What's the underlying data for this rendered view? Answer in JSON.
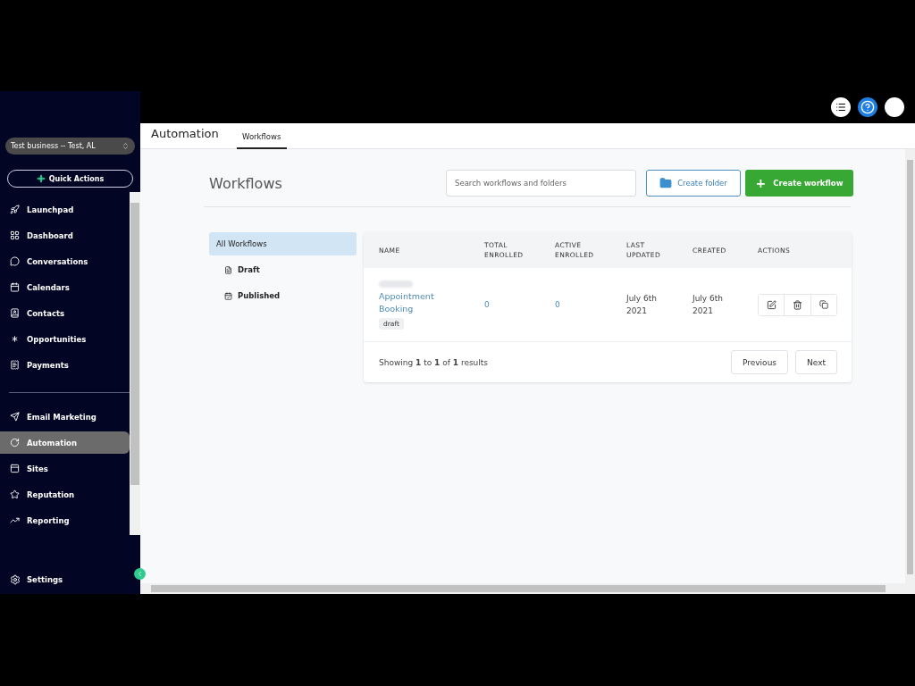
{
  "sidebar": {
    "business": "Test business -- Test, AL",
    "quick_actions": "Quick Actions",
    "items": [
      {
        "label": "Launchpad",
        "selected": false
      },
      {
        "label": "Dashboard",
        "selected": false
      },
      {
        "label": "Conversations",
        "selected": false
      },
      {
        "label": "Calendars",
        "selected": false
      },
      {
        "label": "Contacts",
        "selected": false
      },
      {
        "label": "Opportunities",
        "selected": false
      },
      {
        "label": "Payments",
        "selected": false
      }
    ],
    "items_secondary": [
      {
        "label": "Email Marketing",
        "selected": false
      },
      {
        "label": "Automation",
        "selected": true
      },
      {
        "label": "Sites",
        "selected": false
      },
      {
        "label": "Reputation",
        "selected": false
      },
      {
        "label": "Reporting",
        "selected": false
      }
    ],
    "settings": "Settings"
  },
  "header": {
    "title": "Automation",
    "tabs": [
      {
        "label": "Workflows",
        "selected": true
      }
    ]
  },
  "page": {
    "title": "Workflows",
    "search": {
      "placeholder": "Search workflows and folders"
    },
    "create_folder": "Create folder",
    "create_workflow_icon": "+",
    "create_workflow": "Create workflow"
  },
  "folders": [
    {
      "label": "All Workflows",
      "selected": true
    },
    {
      "label": "Draft",
      "selected": false
    },
    {
      "label": "Published",
      "selected": false
    }
  ],
  "table": {
    "columns": [
      [
        "NAME"
      ],
      [
        "TOTAL",
        "ENROLLED"
      ],
      [
        "ACTIVE",
        "ENROLLED"
      ],
      [
        "LAST",
        "UPDATED"
      ],
      [
        "CREATED"
      ],
      [
        "ACTIONS"
      ]
    ],
    "rows": [
      {
        "name": "Appointment Booking",
        "status": "draft",
        "total_enrolled": "0",
        "active_enrolled": "0",
        "last_updated": "July 6th 2021",
        "created": "July 6th 2021"
      }
    ]
  },
  "pagination": {
    "summary": "Showing **1** to **1** of **1** results",
    "previous": "Previous",
    "next": "Next"
  }
}
